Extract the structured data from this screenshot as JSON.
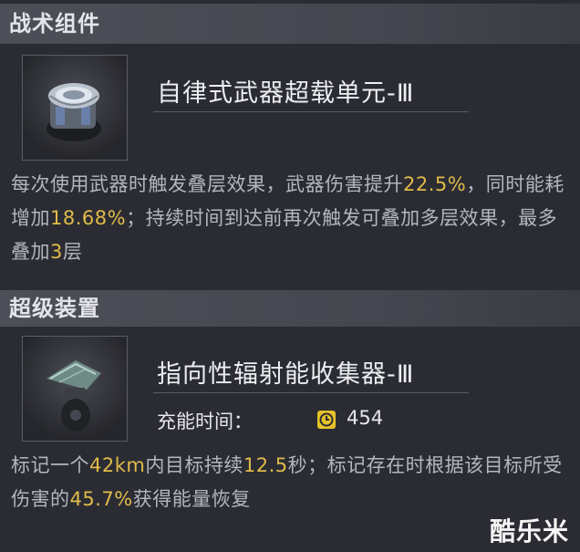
{
  "sections": {
    "tactical": {
      "title": "战术组件",
      "item": {
        "icon": "device-ring-icon",
        "name": "自律式武器超载单元-Ⅲ",
        "description": {
          "p1": "每次使用武器时触发叠层效果，武器伤害提升",
          "v1": "22.5%",
          "p2": "，同时能耗增加",
          "v2": "18.68%",
          "p3": "；持续时间到达前再次触发可叠加多层效果，最多叠加",
          "v3": "3",
          "p4": "层"
        }
      }
    },
    "super_device": {
      "title": "超级装置",
      "item": {
        "icon": "device-emitter-icon",
        "name": "指向性辐射能收集器-Ⅲ",
        "charge_label": "充能时间：",
        "charge_icon": "clock-icon",
        "charge_value": "454",
        "description": {
          "p1": "标记一个",
          "v1": "42km",
          "p2": "内目标持续",
          "v2": "12.5",
          "p3": "秒；标记存在时根据该目标所受伤害的",
          "v3": "45.7%",
          "p4": "获得能量恢复"
        }
      }
    }
  },
  "watermark": "酷乐米",
  "colors": {
    "background": "#2b2c33",
    "header": "#4d4f58",
    "highlight": "#e0bb4a",
    "charge_icon": "#e6c229"
  }
}
